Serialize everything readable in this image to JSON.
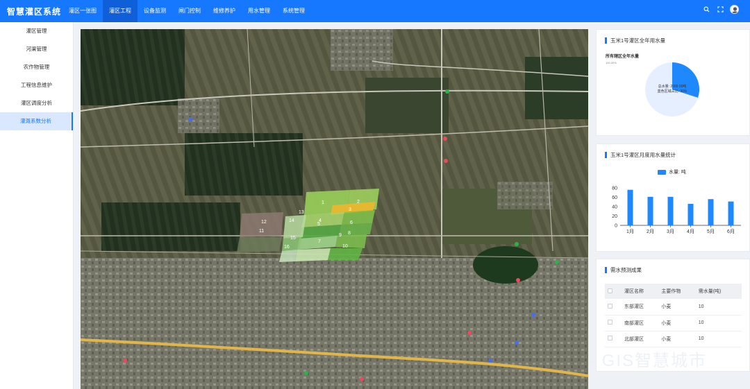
{
  "app": {
    "title": "智慧灌区系统"
  },
  "nav": [
    {
      "label": "灌区一张图"
    },
    {
      "label": "灌区工程",
      "active": true
    },
    {
      "label": "设备监测"
    },
    {
      "label": "闸门控制"
    },
    {
      "label": "维修养护"
    },
    {
      "label": "用水管理"
    },
    {
      "label": "系统管理"
    }
  ],
  "tools": {
    "search": "search-icon",
    "fullscreen": "fullscreen-icon",
    "avatar": "user-avatar"
  },
  "sidebar": {
    "items": [
      {
        "label": "灌区管理"
      },
      {
        "label": "河渠管理"
      },
      {
        "label": "农作物管理"
      },
      {
        "label": "工程信息维护"
      },
      {
        "label": "灌区调度分析"
      },
      {
        "label": "灌溉系数分析",
        "active": true
      }
    ]
  },
  "map": {
    "field_labels": [
      "1",
      "2",
      "3",
      "4",
      "5",
      "6",
      "7",
      "8",
      "9",
      "10",
      "11",
      "12",
      "13",
      "14",
      "15",
      "16"
    ]
  },
  "annual_panel": {
    "title": "玉米1号灌区全年用水量",
    "chart_title": "所有辖区全年水量",
    "chart_subtitle": "100.00%",
    "center_text_1": "总水量: 2000 00吨",
    "center_text_2": "蓝色区域占比: 30%"
  },
  "monthly_panel": {
    "title": "玉米1号灌区月度用水量统计"
  },
  "forecast_panel": {
    "title": "需水预测成果",
    "columns": [
      "灌区名称",
      "主要作物",
      "需水量(吨)"
    ],
    "rows": [
      [
        "东部灌区",
        "小麦",
        "10"
      ],
      [
        "南部灌区",
        "小麦",
        "10"
      ],
      [
        "北部灌区",
        "小麦",
        "10"
      ]
    ]
  },
  "watermark": "· GIS智慧城市",
  "colors": {
    "primary": "#1677ff",
    "bar": "#1e88ff",
    "pie_light": "#e6efff"
  },
  "chart_data": [
    {
      "type": "pie",
      "title": "所有辖区全年水量",
      "slices": [
        {
          "label": "蓝色区域",
          "value": 30,
          "color": "#1e88ff"
        },
        {
          "label": "",
          "value": 70,
          "color": "#e6efff"
        }
      ]
    },
    {
      "type": "bar",
      "categories": [
        "1月",
        "2月",
        "3月",
        "4月",
        "5月",
        "6月"
      ],
      "series": [
        {
          "name": "水量: 吨",
          "values": [
            76,
            61,
            61,
            46,
            56,
            51
          ]
        }
      ],
      "ylim": [
        0,
        80
      ],
      "yticks": [
        0,
        20,
        40,
        60,
        80
      ],
      "grid": false,
      "legend": "top"
    }
  ]
}
